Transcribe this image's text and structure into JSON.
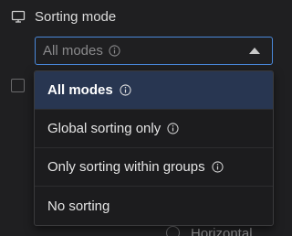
{
  "section": {
    "title": "Sorting mode",
    "icon": "monitor-icon"
  },
  "select": {
    "value": "All modes",
    "info_icon": "info-icon",
    "arrow_icon": "chevron-up-icon",
    "accent_color": "#4a88d9"
  },
  "menu": {
    "items": [
      {
        "label": "All modes",
        "selected": true,
        "has_info": true
      },
      {
        "label": "Global sorting only",
        "selected": false,
        "has_info": true
      },
      {
        "label": "Only sorting within groups",
        "selected": false,
        "has_info": true
      },
      {
        "label": "No sorting",
        "selected": false,
        "has_info": false
      }
    ],
    "selected_bg": "#283651"
  },
  "background": {
    "radio_label": "Horizontal"
  }
}
